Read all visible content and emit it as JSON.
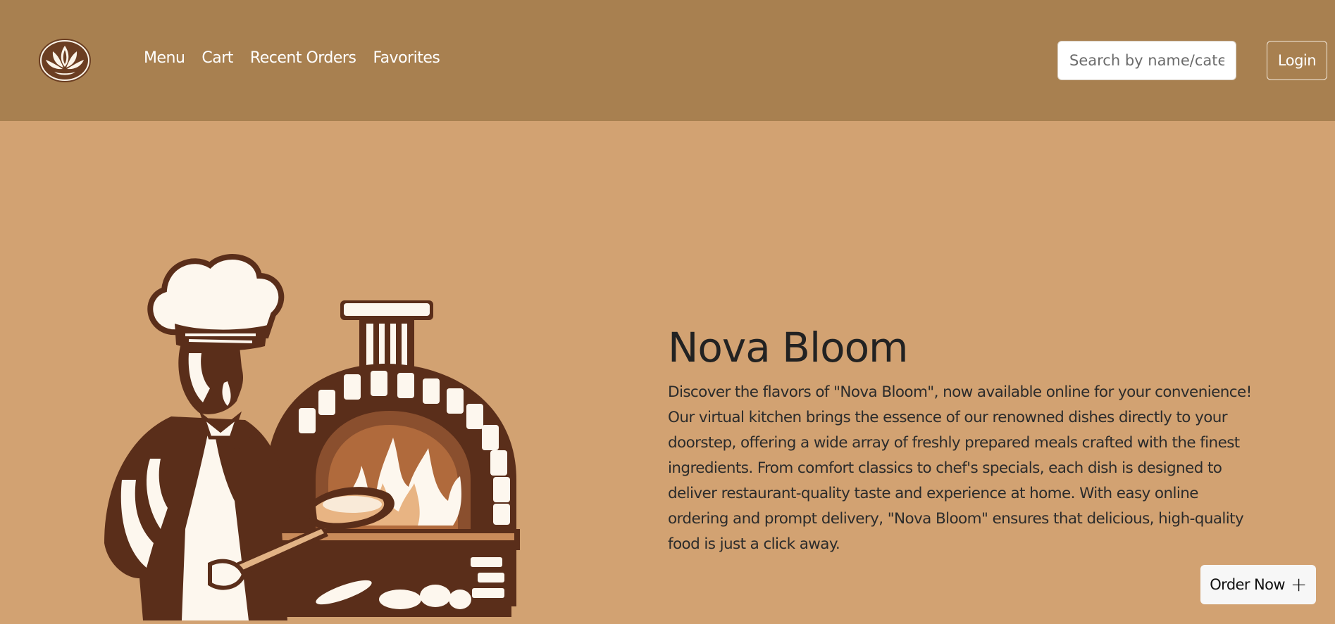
{
  "header": {
    "logo_icon": "lotus-logo-icon",
    "nav": [
      {
        "label": "Menu"
      },
      {
        "label": "Cart"
      },
      {
        "label": "Recent Orders"
      },
      {
        "label": "Favorites"
      }
    ],
    "search": {
      "placeholder": "Search by name/cate",
      "value": ""
    },
    "login_label": "Login"
  },
  "hero": {
    "image_icon": "chef-pizza-oven-illustration",
    "title": "Nova Bloom",
    "description": "Discover the flavors of \"Nova Bloom\", now available online for your convenience! Our virtual kitchen brings the essence of our renowned dishes directly to your doorstep, offering a wide array of freshly prepared meals crafted with the finest ingredients. From comfort classics to chef's specials, each dish is designed to deliver restaurant-quality taste and experience at home. With easy online ordering and prompt delivery, \"Nova Bloom\" ensures that delicious, high-quality food is just a click away.",
    "order_label": "Order Now",
    "order_icon": "plus-icon"
  },
  "colors": {
    "navbar": "#a88050",
    "background": "#d2a272",
    "illustration_dark": "#5a2e1a",
    "illustration_light": "#fdf7ee"
  }
}
